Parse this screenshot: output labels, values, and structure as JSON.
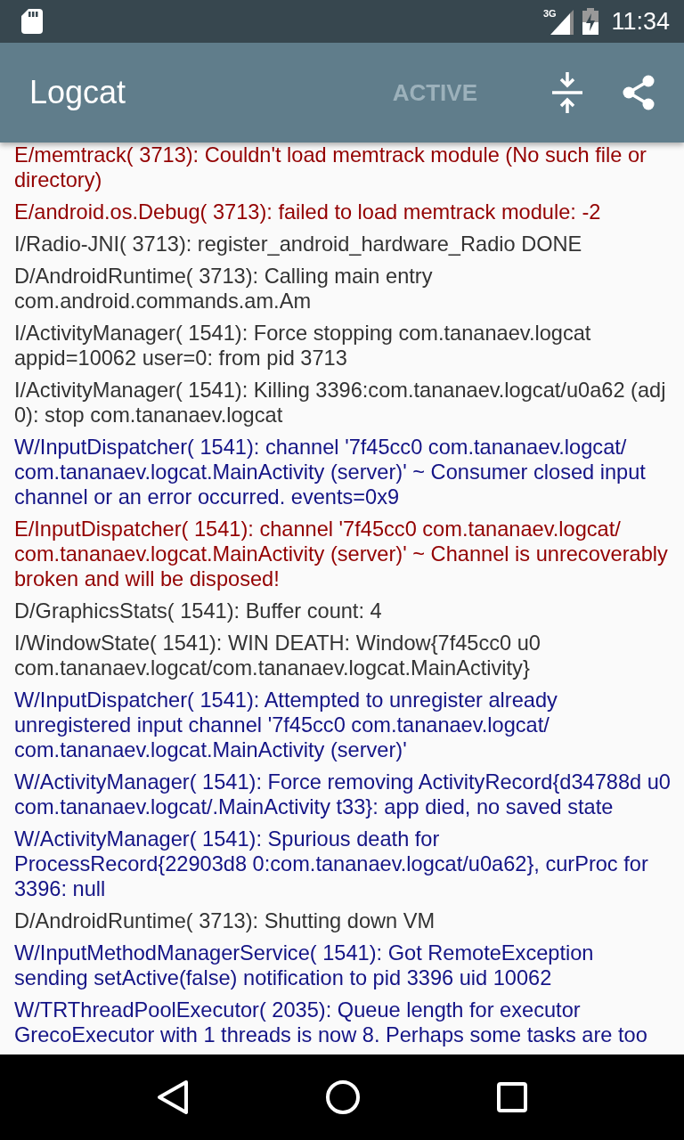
{
  "status_bar": {
    "time": "11:34",
    "network": "3G"
  },
  "app_bar": {
    "title": "Logcat",
    "action": {
      "label": "ACTIVE",
      "disabled": true
    }
  },
  "log": [
    {
      "kind": "error",
      "text": "E/memtrack( 3713): Couldn't load memtrack module (No such file or directory)"
    },
    {
      "kind": "error",
      "text": "E/android.os.Debug( 3713): failed to load memtrack module: -2"
    },
    {
      "kind": "info",
      "text": "I/Radio-JNI( 3713): register_android_hardware_Radio DONE"
    },
    {
      "kind": "debug",
      "text": "D/AndroidRuntime( 3713): Calling main entry com.android.commands.am.Am"
    },
    {
      "kind": "info",
      "text": "I/ActivityManager( 1541): Force stopping com.tananaev.logcat appid=10062 user=0: from pid 3713"
    },
    {
      "kind": "info",
      "text": "I/ActivityManager( 1541): Killing 3396:com.tananaev.logcat/u0a62 (adj 0): stop com.tananaev.logcat"
    },
    {
      "kind": "warning",
      "text": "W/InputDispatcher( 1541): channel '7f45cc0 com.tananaev.logcat/ com.tananaev.logcat.MainActivity (server)' ~ Consumer closed input channel or an error occurred.  events=0x9"
    },
    {
      "kind": "error",
      "text": "E/InputDispatcher( 1541): channel '7f45cc0 com.tananaev.logcat/ com.tananaev.logcat.MainActivity (server)' ~ Channel is unrecoverably broken and will be disposed!"
    },
    {
      "kind": "debug",
      "text": "D/GraphicsStats( 1541): Buffer count: 4"
    },
    {
      "kind": "info",
      "text": "I/WindowState( 1541): WIN DEATH: Window{7f45cc0 u0 com.tananaev.logcat/com.tananaev.logcat.MainActivity}"
    },
    {
      "kind": "warning",
      "text": "W/InputDispatcher( 1541): Attempted to unregister already unregistered input channel '7f45cc0 com.tananaev.logcat/ com.tananaev.logcat.MainActivity (server)'"
    },
    {
      "kind": "warning",
      "text": "W/ActivityManager( 1541): Force removing ActivityRecord{d34788d u0 com.tananaev.logcat/.MainActivity t33}: app died, no saved state"
    },
    {
      "kind": "warning",
      "text": "W/ActivityManager( 1541): Spurious death for ProcessRecord{22903d8 0:com.tananaev.logcat/u0a62}, curProc for 3396: null"
    },
    {
      "kind": "debug",
      "text": "D/AndroidRuntime( 3713): Shutting down VM"
    },
    {
      "kind": "warning",
      "text": "W/InputMethodManagerService( 1541): Got RemoteException sending setActive(false) notification to pid 3396 uid 10062"
    },
    {
      "kind": "warning",
      "text": "W/TRThreadPoolExecutor( 2035): Queue length for executor GrecoExecutor with 1 threads is now 8. Perhaps some tasks are too"
    }
  ]
}
